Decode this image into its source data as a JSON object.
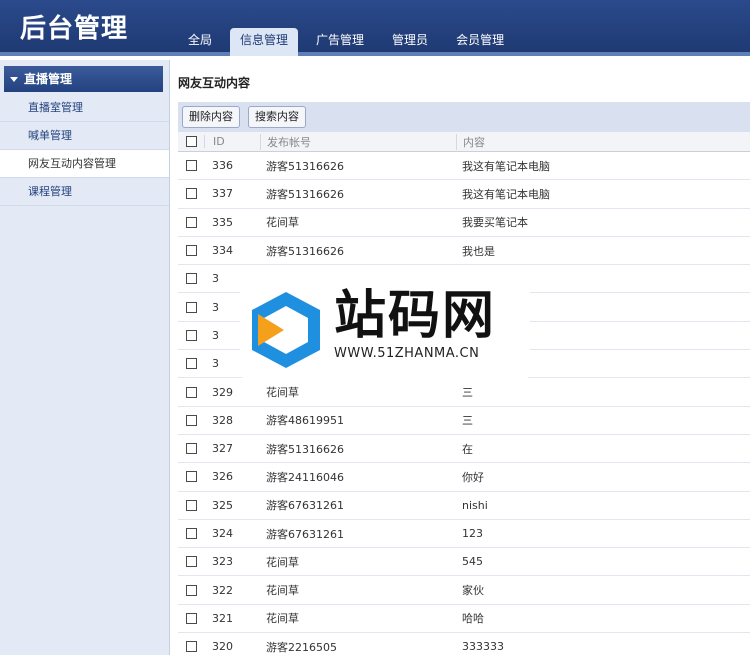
{
  "header": {
    "title": "后台管理",
    "nav": [
      "全局",
      "信息管理",
      "广告管理",
      "管理员",
      "会员管理"
    ],
    "active_nav": 1
  },
  "sidebar": {
    "section": "直播管理",
    "items": [
      "直播室管理",
      "喊单管理",
      "网友互动内容管理",
      "课程管理"
    ],
    "active_item": 2
  },
  "main": {
    "title": "网友互动内容",
    "buttons": {
      "delete": "删除内容",
      "search": "搜索内容"
    },
    "columns": {
      "id": "ID",
      "account": "发布帐号",
      "content": "内容"
    },
    "rows": [
      {
        "id": "336",
        "account": "游客51316626",
        "content": "我这有笔记本电脑"
      },
      {
        "id": "337",
        "account": "游客51316626",
        "content": "我这有笔记本电脑"
      },
      {
        "id": "335",
        "account": "花间草",
        "content": "我要买笔记本"
      },
      {
        "id": "334",
        "account": "游客51316626",
        "content": "我也是"
      },
      {
        "id": "3",
        "account": "",
        "content": ""
      },
      {
        "id": "3",
        "account": "",
        "content": ""
      },
      {
        "id": "3",
        "account": "",
        "content": ""
      },
      {
        "id": "3",
        "account": "",
        "content": ""
      },
      {
        "id": "329",
        "account": "花间草",
        "content": "三"
      },
      {
        "id": "328",
        "account": "游客48619951",
        "content": "三"
      },
      {
        "id": "327",
        "account": "游客51316626",
        "content": "在"
      },
      {
        "id": "326",
        "account": "游客24116046",
        "content": "你好"
      },
      {
        "id": "325",
        "account": "游客67631261",
        "content": "nishi"
      },
      {
        "id": "324",
        "account": "游客67631261",
        "content": "123"
      },
      {
        "id": "323",
        "account": "花间草",
        "content": "545"
      },
      {
        "id": "322",
        "account": "花间草",
        "content": "家伙"
      },
      {
        "id": "321",
        "account": "花间草",
        "content": "哈哈"
      },
      {
        "id": "320",
        "account": "游客2216505",
        "content": "333333"
      }
    ]
  },
  "watermark": {
    "name": "站码网",
    "url": "WWW.51ZHANMA.CN"
  },
  "colors": {
    "header": "#1f3a73",
    "accent": "#24427f",
    "logo_blue": "#1f8fe0",
    "logo_orange": "#f5a01a"
  }
}
